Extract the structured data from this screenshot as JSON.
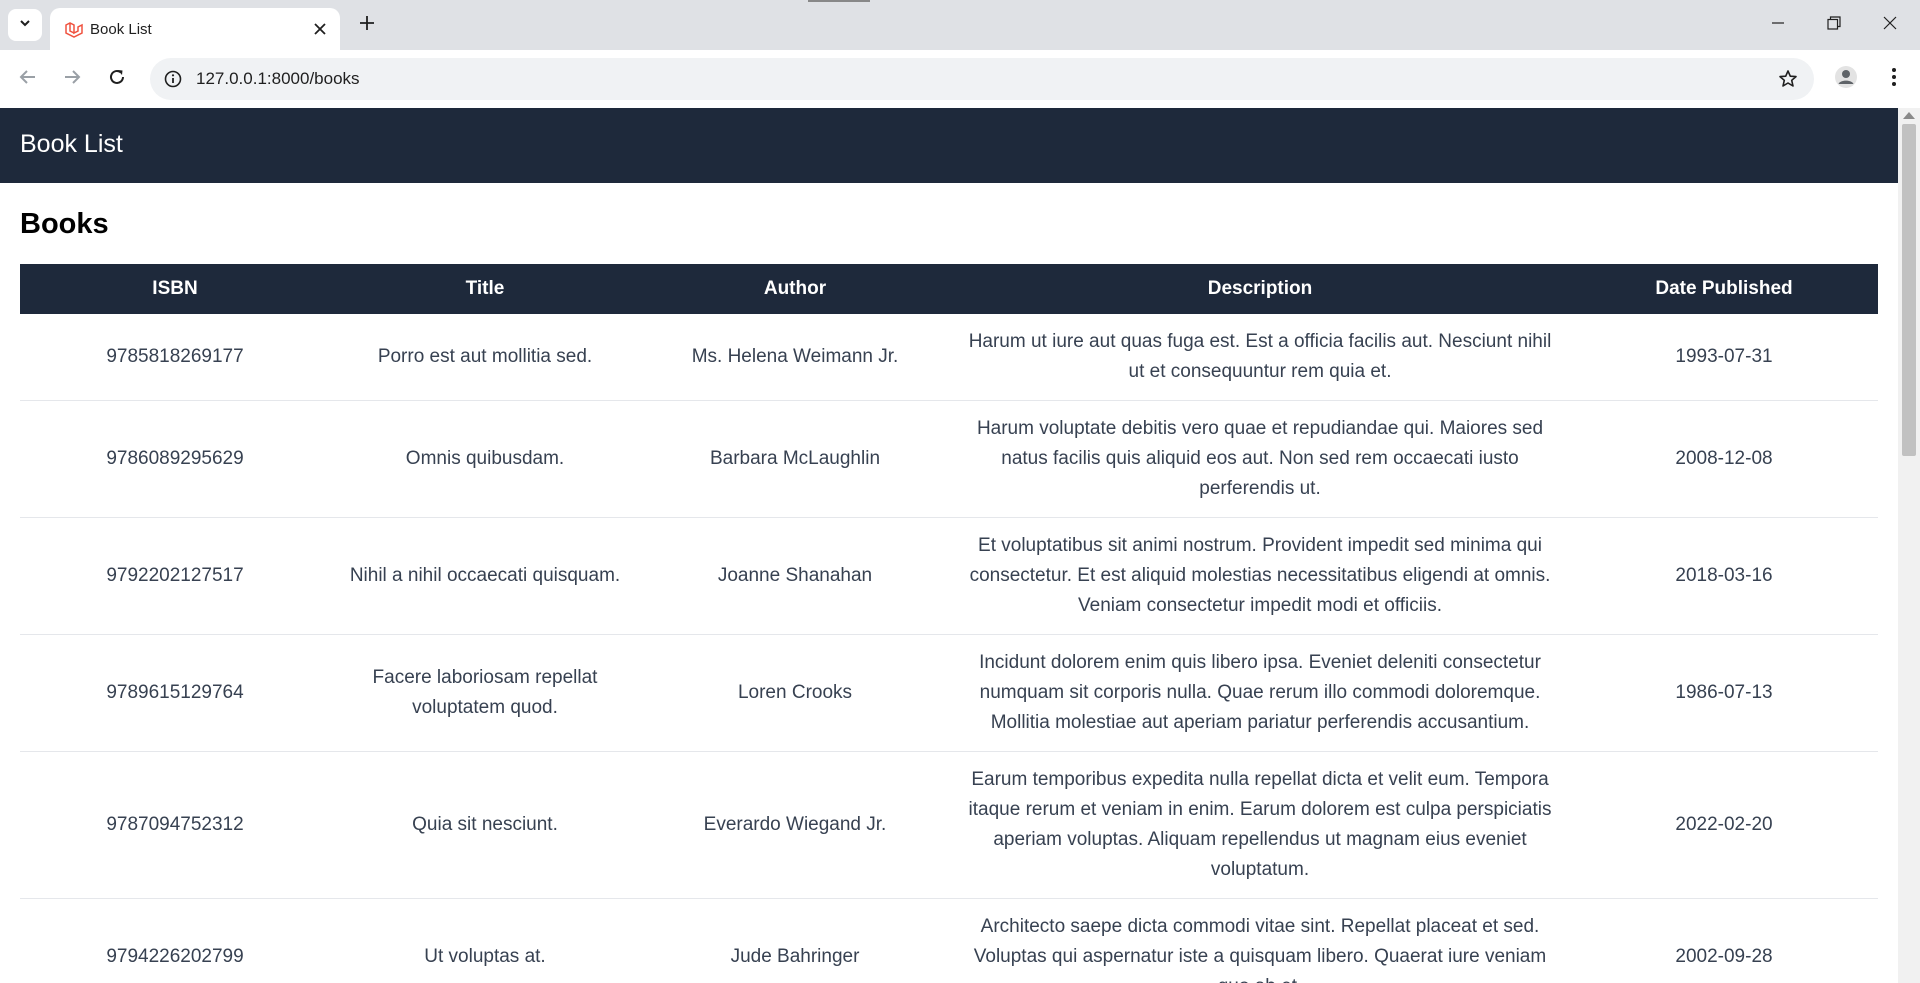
{
  "browser": {
    "tab_title": "Book List",
    "url": "127.0.0.1:8000/books",
    "accent_color": "#f05340"
  },
  "page": {
    "navbar_title": "Book List",
    "heading": "Books",
    "navbar_color": "#1e293b",
    "table": {
      "headers": [
        "ISBN",
        "Title",
        "Author",
        "Description",
        "Date Published"
      ],
      "rows": [
        {
          "isbn": "9785818269177",
          "title": "Porro est aut mollitia sed.",
          "author": "Ms. Helena Weimann Jr.",
          "description": "Harum ut iure aut quas fuga est. Est a officia facilis aut. Nesciunt nihil ut et consequuntur rem quia et.",
          "date": "1993-07-31"
        },
        {
          "isbn": "9786089295629",
          "title": "Omnis quibusdam.",
          "author": "Barbara McLaughlin",
          "description": "Harum voluptate debitis vero quae et repudiandae qui. Maiores sed natus facilis quis aliquid eos aut. Non sed rem occaecati iusto perferendis ut.",
          "date": "2008-12-08"
        },
        {
          "isbn": "9792202127517",
          "title": "Nihil a nihil occaecati quisquam.",
          "author": "Joanne Shanahan",
          "description": "Et voluptatibus sit animi nostrum. Provident impedit sed minima qui consectetur. Et est aliquid molestias necessitatibus eligendi at omnis. Veniam consectetur impedit modi et officiis.",
          "date": "2018-03-16"
        },
        {
          "isbn": "9789615129764",
          "title": "Facere laboriosam repellat voluptatem quod.",
          "author": "Loren Crooks",
          "description": "Incidunt dolorem enim quis libero ipsa. Eveniet deleniti consectetur numquam sit corporis nulla. Quae rerum illo commodi doloremque. Mollitia molestiae aut aperiam pariatur perferendis accusantium.",
          "date": "1986-07-13"
        },
        {
          "isbn": "9787094752312",
          "title": "Quia sit nesciunt.",
          "author": "Everardo Wiegand Jr.",
          "description": "Earum temporibus expedita nulla repellat dicta et velit eum. Tempora itaque rerum et veniam in enim. Earum dolorem est culpa perspiciatis aperiam voluptas. Aliquam repellendus ut magnam eius eveniet voluptatum.",
          "date": "2022-02-20"
        },
        {
          "isbn": "9794226202799",
          "title": "Ut voluptas at.",
          "author": "Jude Bahringer",
          "description": "Architecto saepe dicta commodi vitae sint. Repellat placeat et sed. Voluptas qui aspernatur iste a quisquam libero. Quaerat iure veniam quo ab et.",
          "date": "2002-09-28"
        }
      ]
    }
  }
}
